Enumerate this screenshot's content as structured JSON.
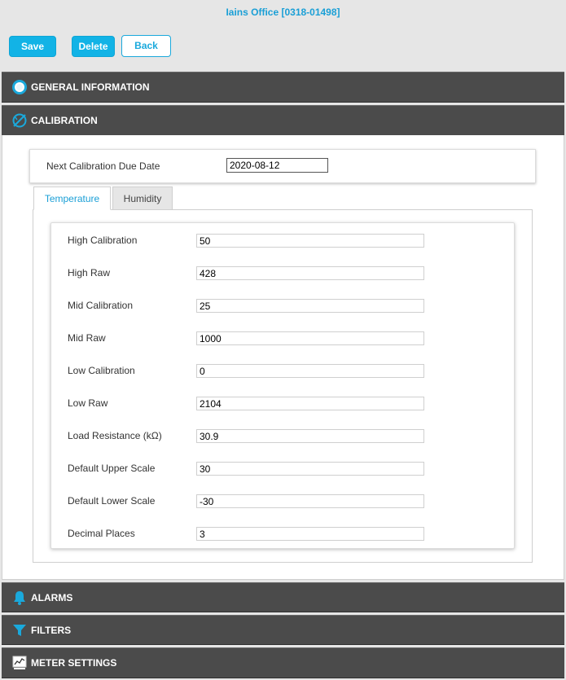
{
  "header": {
    "title": "Iains Office [0318-01498]"
  },
  "toolbar": {
    "save_label": "Save",
    "delete_label": "Delete",
    "back_label": "Back"
  },
  "sections": {
    "general": "GENERAL INFORMATION",
    "calibration": "CALIBRATION",
    "alarms": "ALARMS",
    "filters": "FILTERS",
    "meter_settings": "METER SETTINGS"
  },
  "calibration": {
    "due_date_label": "Next Calibration Due Date",
    "due_date_value": "2020-08-12",
    "tabs": [
      "Temperature",
      "Humidity"
    ],
    "active_tab": "Temperature",
    "fields": [
      {
        "label": "High Calibration",
        "value": "50"
      },
      {
        "label": "High Raw",
        "value": "428"
      },
      {
        "label": "Mid Calibration",
        "value": "25"
      },
      {
        "label": "Mid Raw",
        "value": "1000"
      },
      {
        "label": "Low Calibration",
        "value": "0"
      },
      {
        "label": "Low Raw",
        "value": "2104"
      },
      {
        "label": "Load Resistance (kΩ)",
        "value": "30.9"
      },
      {
        "label": "Default Upper Scale",
        "value": "30"
      },
      {
        "label": "Default Lower Scale",
        "value": "-30"
      },
      {
        "label": "Decimal Places",
        "value": "3"
      }
    ]
  },
  "colors": {
    "accent": "#12b3e6",
    "bar": "#4b4b4b",
    "title": "#1a9fd6"
  },
  "icons": {
    "general": "radio-circle-icon",
    "calibration": "compass-icon",
    "alarms": "bell-icon",
    "filters": "funnel-icon",
    "meter_settings": "meter-chart-icon"
  }
}
